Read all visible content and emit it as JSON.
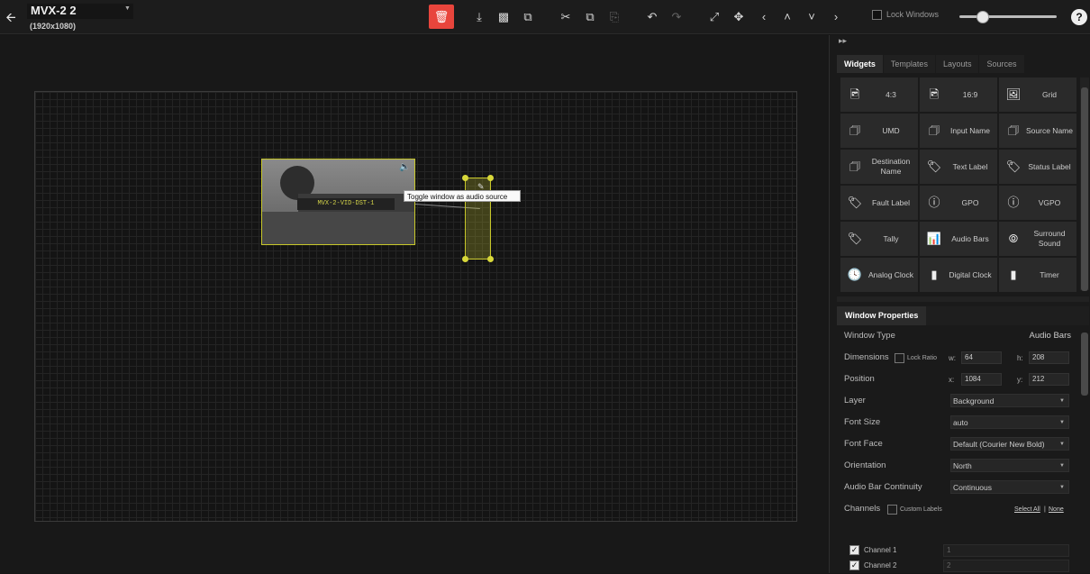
{
  "header": {
    "title": "MVX-2 2",
    "resolution": "(1920x1080)"
  },
  "toolbar": {
    "lock_windows_label": "Lock Windows",
    "zoom_level": 0.24
  },
  "canvas": {
    "video_window_label": "MVX-2-VID-DST-1",
    "tooltip": "Toggle window as audio source"
  },
  "panel": {
    "tabs": [
      {
        "label": "Widgets"
      },
      {
        "label": "Templates"
      },
      {
        "label": "Layouts"
      },
      {
        "label": "Sources"
      }
    ],
    "widgets": [
      {
        "label": "4:3",
        "icon": "image-icon"
      },
      {
        "label": "16:9",
        "icon": "image-icon"
      },
      {
        "label": "Grid",
        "icon": "grid-image-icon"
      },
      {
        "label": "UMD",
        "icon": "id-card-icon"
      },
      {
        "label": "Input Name",
        "icon": "id-card-icon"
      },
      {
        "label": "Source Name",
        "icon": "id-card-icon"
      },
      {
        "label": "Destination Name",
        "icon": "id-card-icon"
      },
      {
        "label": "Text Label",
        "icon": "tag-icon"
      },
      {
        "label": "Status Label",
        "icon": "tag-icon"
      },
      {
        "label": "Fault Label",
        "icon": "tag-icon"
      },
      {
        "label": "GPO",
        "icon": "alert-circle-icon"
      },
      {
        "label": "VGPO",
        "icon": "alert-circle-icon"
      },
      {
        "label": "Tally",
        "icon": "tag-icon"
      },
      {
        "label": "Audio Bars",
        "icon": "bar-chart-icon"
      },
      {
        "label": "Surround Sound",
        "icon": "broadcast-icon"
      },
      {
        "label": "Analog Clock",
        "icon": "clock-icon"
      },
      {
        "label": "Digital Clock",
        "icon": "digital-clock-icon"
      },
      {
        "label": "Timer",
        "icon": "digital-clock-icon"
      }
    ],
    "window_properties": {
      "header": "Window Properties",
      "window_type_label": "Window Type",
      "window_type_value": "Audio Bars",
      "dimensions_label": "Dimensions",
      "lock_ratio_label": "Lock Ratio",
      "w_label": "w:",
      "w_value": "64",
      "h_label": "h:",
      "h_value": "208",
      "position_label": "Position",
      "x_label": "x:",
      "x_value": "1084",
      "y_label": "y:",
      "y_value": "212",
      "layer_label": "Layer",
      "layer_value": "Background",
      "font_size_label": "Font Size",
      "font_size_value": "auto",
      "font_face_label": "Font Face",
      "font_face_value": "Default (Courier New Bold)",
      "orientation_label": "Orientation",
      "orientation_value": "North",
      "continuity_label": "Audio Bar Continuity",
      "continuity_value": "Continuous",
      "channels_label": "Channels",
      "custom_labels_label": "Custom Labels",
      "select_all_label": "Select All",
      "select_sep": "|",
      "select_none_label": "None",
      "channels": [
        {
          "label": "Channel 1",
          "value": "1"
        },
        {
          "label": "Channel 2",
          "value": "2"
        }
      ]
    }
  }
}
